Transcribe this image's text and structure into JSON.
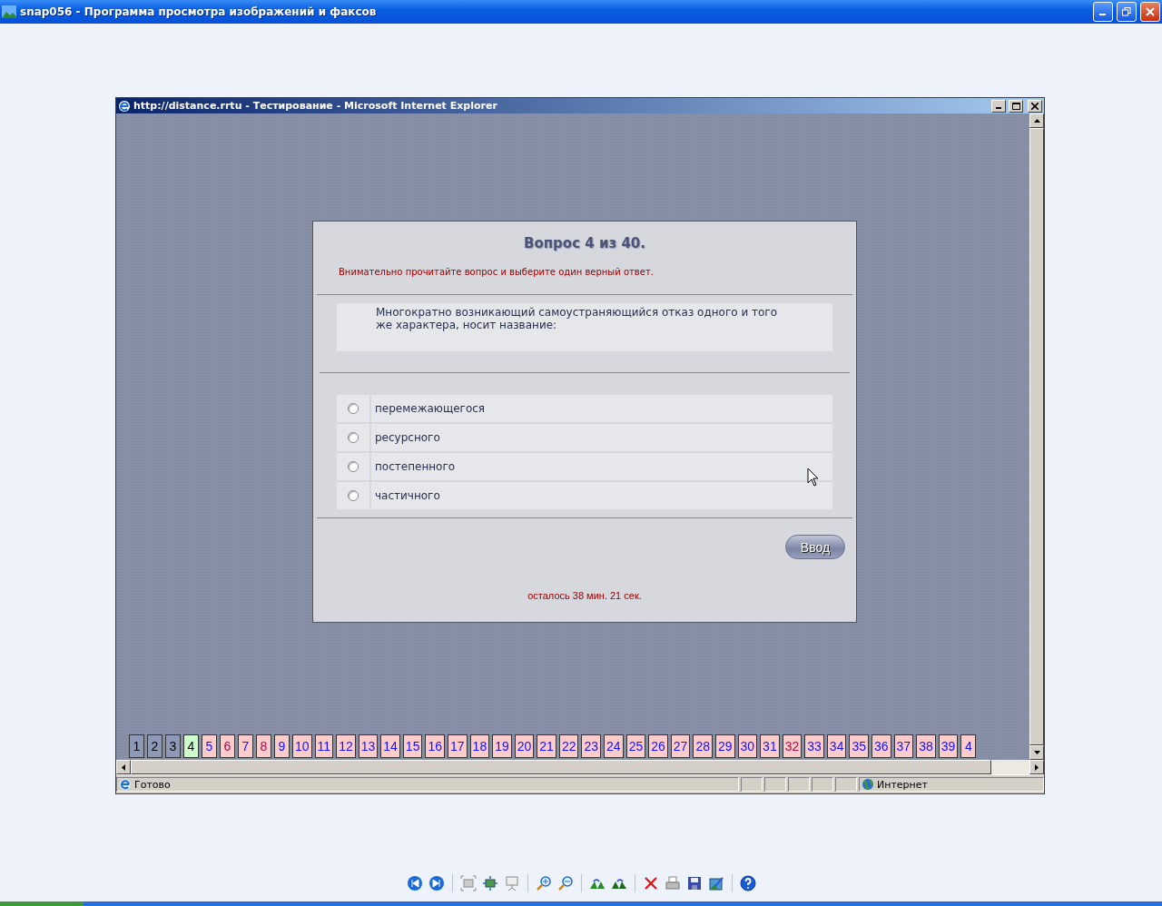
{
  "viewer_title": "snap056 - Программа просмотра изображений и факсов",
  "browser": {
    "title": "http://distance.rrtu - Тестирование - Microsoft Internet Explorer",
    "test": {
      "heading": "Вопрос 4 из 40.",
      "instruction": "Внимательно прочитайте вопрос и выберите один верный ответ.",
      "question": "Многократно возникающий самоустраняющийся отказ одного и того же характера, носит название:",
      "options": [
        {
          "label": "перемежающегося",
          "selected": false
        },
        {
          "label": "ресурсного",
          "selected": false
        },
        {
          "label": "постепенного",
          "selected": false
        },
        {
          "label": "частичного",
          "selected": false
        }
      ],
      "submit": "Ввод",
      "timer": "осталось 38 мин. 21 сек."
    },
    "question_nav": [
      {
        "label": "1",
        "kind": "answered",
        "flagged": false
      },
      {
        "label": "2",
        "kind": "answered",
        "flagged": false
      },
      {
        "label": "3",
        "kind": "answered",
        "flagged": false
      },
      {
        "label": "4",
        "kind": "current",
        "flagged": false
      },
      {
        "label": "5",
        "kind": "open",
        "flagged": false
      },
      {
        "label": "6",
        "kind": "open",
        "flagged": true
      },
      {
        "label": "7",
        "kind": "open",
        "flagged": false
      },
      {
        "label": "8",
        "kind": "open",
        "flagged": true
      },
      {
        "label": "9",
        "kind": "open",
        "flagged": false
      },
      {
        "label": "10",
        "kind": "open",
        "flagged": false
      },
      {
        "label": "11",
        "kind": "open",
        "flagged": false
      },
      {
        "label": "12",
        "kind": "open",
        "flagged": false
      },
      {
        "label": "13",
        "kind": "open",
        "flagged": false
      },
      {
        "label": "14",
        "kind": "open",
        "flagged": false
      },
      {
        "label": "15",
        "kind": "open",
        "flagged": false
      },
      {
        "label": "16",
        "kind": "open",
        "flagged": false
      },
      {
        "label": "17",
        "kind": "open",
        "flagged": false
      },
      {
        "label": "18",
        "kind": "open",
        "flagged": false
      },
      {
        "label": "19",
        "kind": "open",
        "flagged": false
      },
      {
        "label": "20",
        "kind": "open",
        "flagged": false
      },
      {
        "label": "21",
        "kind": "open",
        "flagged": false
      },
      {
        "label": "22",
        "kind": "open",
        "flagged": false
      },
      {
        "label": "23",
        "kind": "open",
        "flagged": false
      },
      {
        "label": "24",
        "kind": "open",
        "flagged": false
      },
      {
        "label": "25",
        "kind": "open",
        "flagged": false
      },
      {
        "label": "26",
        "kind": "open",
        "flagged": false
      },
      {
        "label": "27",
        "kind": "open",
        "flagged": false
      },
      {
        "label": "28",
        "kind": "open",
        "flagged": false
      },
      {
        "label": "29",
        "kind": "open",
        "flagged": false
      },
      {
        "label": "30",
        "kind": "open",
        "flagged": false
      },
      {
        "label": "31",
        "kind": "open",
        "flagged": false
      },
      {
        "label": "32",
        "kind": "open",
        "flagged": true
      },
      {
        "label": "33",
        "kind": "open",
        "flagged": false
      },
      {
        "label": "34",
        "kind": "open",
        "flagged": false
      },
      {
        "label": "35",
        "kind": "open",
        "flagged": false
      },
      {
        "label": "36",
        "kind": "open",
        "flagged": false
      },
      {
        "label": "37",
        "kind": "open",
        "flagged": false
      },
      {
        "label": "38",
        "kind": "open",
        "flagged": false
      },
      {
        "label": "39",
        "kind": "open",
        "flagged": false
      },
      {
        "label": "4",
        "kind": "open",
        "flagged": false
      }
    ],
    "status_text": "Готово",
    "zone": "Интернет"
  }
}
